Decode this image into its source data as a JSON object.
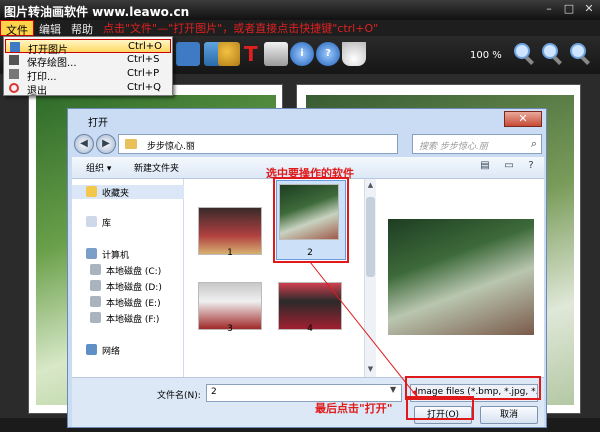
{
  "app": {
    "title": "图片转油画软件 www.leawo.cn",
    "window_controls": [
      "–",
      "□",
      "✕"
    ]
  },
  "menubar": {
    "items": [
      "文件",
      "编辑",
      "帮助"
    ],
    "active": "文件"
  },
  "annotations": {
    "top": "点击\"文件\"—\"打开图片\"，或者直接点击快捷键\"ctrl+O\"",
    "middle": "选中要操作的软件",
    "bottom": "最后点击\"打开\""
  },
  "toolbar": {
    "zoom_level": "100 %"
  },
  "file_menu": {
    "items": [
      {
        "label": "打开图片",
        "shortcut": "Ctrl+O",
        "icon": "open-image-icon"
      },
      {
        "label": "保存绘图...",
        "shortcut": "Ctrl+S",
        "icon": "save-icon"
      },
      {
        "label": "打印...",
        "shortcut": "Ctrl+P",
        "icon": "printer-icon"
      },
      {
        "label": "退出",
        "shortcut": "Ctrl+Q",
        "icon": "power-icon"
      }
    ]
  },
  "dialog": {
    "title": "打开",
    "close": "✕",
    "address": "步步惊心.丽",
    "search_placeholder": "搜索 步步惊心.丽",
    "commands": {
      "organize": "组织 ▾",
      "new_folder": "新建文件夹"
    },
    "nav_pane": {
      "favorites": "收藏夹",
      "library": "库",
      "computer": "计算机",
      "drives": [
        "本地磁盘 (C:)",
        "本地磁盘 (D:)",
        "本地磁盘 (E:)",
        "本地磁盘 (F:)"
      ],
      "network": "网络"
    },
    "thumbnails": [
      "1",
      "2",
      "3",
      "4"
    ],
    "filename_label": "文件名(N):",
    "filename_value": "2",
    "filetype": "Image files (*.bmp, *.jpg, *.jp",
    "open_button": "打开(O)",
    "cancel_button": "取消"
  },
  "colors": {
    "accent_red": "#e01a1a",
    "menu_highlight": "#ffd860",
    "dialog_frame": "#c9dcf3"
  }
}
